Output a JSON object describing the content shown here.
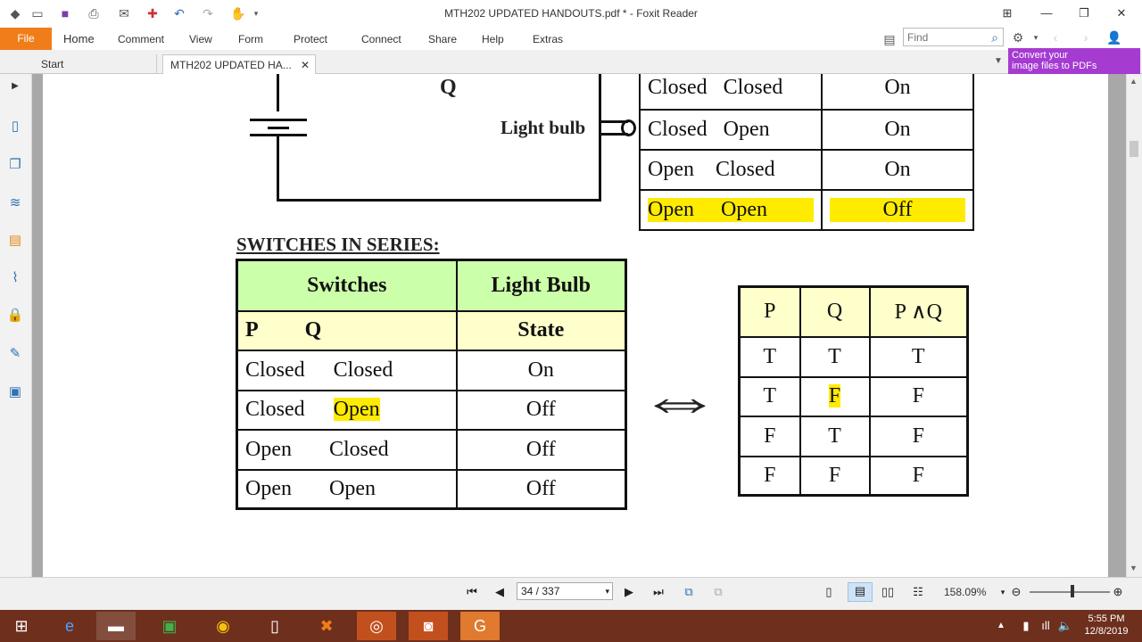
{
  "app": {
    "title": "MTH202 UPDATED HANDOUTS.pdf * - Foxit Reader",
    "menu_file": "File",
    "menus": [
      "Home",
      "Comment",
      "View",
      "Form",
      "Protect",
      "Connect",
      "Share",
      "Help",
      "Extras"
    ],
    "search_placeholder": "Find",
    "tabs": [
      "Start",
      "MTH202 UPDATED HA..."
    ],
    "promo_line1": "Convert your",
    "promo_line2": "image files to PDFs"
  },
  "doc": {
    "label_q": "Q",
    "light_bulb_label": "Light bulb",
    "section_title": "SWITCHES IN SERIES:",
    "top_table_rows": [
      {
        "p": "Closed",
        "q": "Closed",
        "state": "On",
        "highlight": false
      },
      {
        "p": "Closed",
        "q": "Open",
        "state": "On",
        "highlight": false
      },
      {
        "p": "Open",
        "q": "Closed",
        "state": "On",
        "highlight": false
      },
      {
        "p": "Open",
        "q": "Open",
        "state": "Off",
        "highlight": true
      }
    ],
    "series_table": {
      "header_switches": "Switches",
      "header_light": "Light Bulb",
      "sub_p": "P",
      "sub_q": "Q",
      "sub_state": "State",
      "rows": [
        {
          "p": "Closed",
          "q": "Closed",
          "state": "On"
        },
        {
          "p": "Closed",
          "q": "Open",
          "state": "Off"
        },
        {
          "p": "Open",
          "q": "Closed",
          "state": "Off"
        },
        {
          "p": "Open",
          "q": "Open",
          "state": "Off"
        }
      ]
    },
    "truth_table": {
      "headers": [
        "P",
        "Q",
        "P ∧Q"
      ],
      "rows": [
        [
          "T",
          "T",
          "T"
        ],
        [
          "T",
          "F",
          "F"
        ],
        [
          "F",
          "T",
          "F"
        ],
        [
          "F",
          "F",
          "F"
        ]
      ]
    },
    "arrow_symbol": "⇔"
  },
  "status": {
    "page_indicator": "34 / 337",
    "zoom": "158.09%"
  },
  "taskbar": {
    "time": "5:55 PM",
    "date": "12/8/2019"
  },
  "colors": {
    "file_tab": "#f07d1a",
    "highlight": "#ffeb00",
    "header_green": "#ccffaa",
    "header_yellow": "#ffffcc",
    "promo": "#a53bd1",
    "taskbar": "#6e2f1d"
  }
}
